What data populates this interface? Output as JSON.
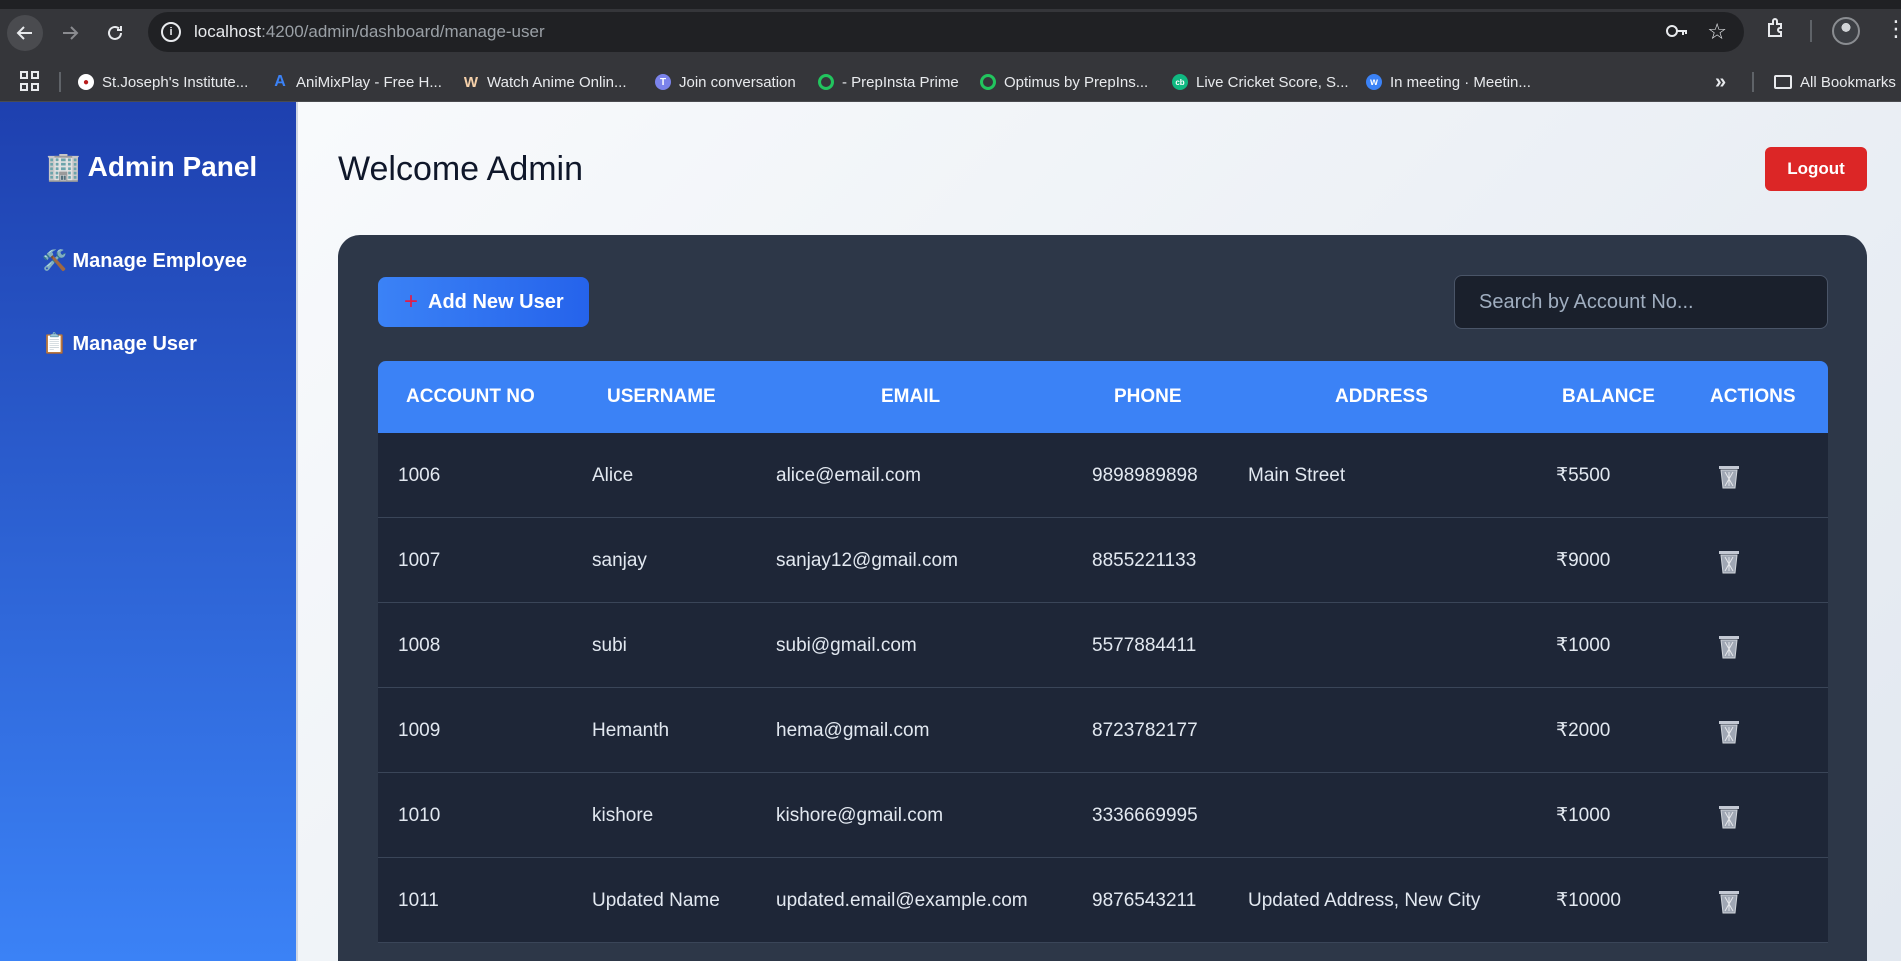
{
  "browser": {
    "url_host": "localhost",
    "url_rest": ":4200/admin/dashboard/manage-user",
    "bookmarks": [
      {
        "label": "St.Joseph's Institute...",
        "icon": "stjoseph-favicon",
        "color": "#ffffff"
      },
      {
        "label": "AniMixPlay - Free H...",
        "icon": "animixplay-favicon",
        "color": "#3b82f6"
      },
      {
        "label": "Watch Anime Onlin...",
        "icon": "anime-favicon",
        "color": "#f5d0a9"
      },
      {
        "label": "Join conversation",
        "icon": "teams-favicon",
        "color": "#7b83eb"
      },
      {
        "label": "- PrepInsta Prime",
        "icon": "prepinsta-favicon",
        "color": "#22c55e"
      },
      {
        "label": "Optimus by PrepIns...",
        "icon": "optimus-favicon",
        "color": "#22c55e"
      },
      {
        "label": "Live Cricket Score, S...",
        "icon": "cricbuzz-favicon",
        "color": "#10b981"
      },
      {
        "label": "In meeting · Meetin...",
        "icon": "webex-favicon",
        "color": "#3b82f6"
      }
    ],
    "all_bookmarks": "All Bookmarks"
  },
  "sidebar": {
    "brand": "🏢 Admin Panel",
    "items": [
      {
        "label": "🛠️ Manage Employee"
      },
      {
        "label": "📋 Manage User"
      }
    ]
  },
  "header": {
    "title": "Welcome Admin",
    "logout_label": "Logout"
  },
  "toolbar": {
    "add_label": "Add New User",
    "search_placeholder": "Search by Account No..."
  },
  "table": {
    "columns": [
      "Account No",
      "Username",
      "Email",
      "Phone",
      "Address",
      "Balance",
      "Actions"
    ],
    "rows": [
      {
        "account": "1006",
        "username": "Alice",
        "email": "alice@email.com",
        "phone": "9898989898",
        "address": "Main Street",
        "balance": "₹5500"
      },
      {
        "account": "1007",
        "username": "sanjay",
        "email": "sanjay12@gmail.com",
        "phone": "8855221133",
        "address": "",
        "balance": "₹9000"
      },
      {
        "account": "1008",
        "username": "subi",
        "email": "subi@gmail.com",
        "phone": "5577884411",
        "address": "",
        "balance": "₹1000"
      },
      {
        "account": "1009",
        "username": "Hemanth",
        "email": "hema@gmail.com",
        "phone": "8723782177",
        "address": "",
        "balance": "₹2000"
      },
      {
        "account": "1010",
        "username": "kishore",
        "email": "kishore@gmail.com",
        "phone": "3336669995",
        "address": "",
        "balance": "₹1000"
      },
      {
        "account": "1011",
        "username": "Updated Name",
        "email": "updated.email@example.com",
        "phone": "9876543211",
        "address": "Updated Address, New City",
        "balance": "₹10000"
      }
    ]
  },
  "colors": {
    "sidebar_top": "#1e40af",
    "sidebar_bottom": "#3b82f6",
    "accent": "#3b82f6",
    "logout": "#dc2626",
    "card": "#2d3748"
  }
}
